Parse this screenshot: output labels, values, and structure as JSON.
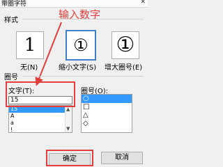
{
  "dialog": {
    "title": "带圈字符",
    "close_glyph": "✕"
  },
  "annotation": {
    "text": "输入数字"
  },
  "style": {
    "section_label": "样式",
    "options": [
      {
        "label": "无(N)",
        "glyph": "1"
      },
      {
        "label": "缩小文字(S)",
        "glyph": "①"
      },
      {
        "label": "增大圈号(E)",
        "glyph": "①"
      }
    ]
  },
  "circle": {
    "section_label": "圈号",
    "text_label": "文字(T):",
    "text_value": "15",
    "text_list": [
      "15",
      "A",
      "a",
      "!"
    ],
    "shape_label": "圈号(O):",
    "shape_list": [
      "○",
      "□",
      "△",
      "◇"
    ]
  },
  "buttons": {
    "ok": "确定",
    "cancel": "取消"
  },
  "colors": {
    "annotation_red": "#e53c3c",
    "selection_blue": "#3399ff"
  }
}
